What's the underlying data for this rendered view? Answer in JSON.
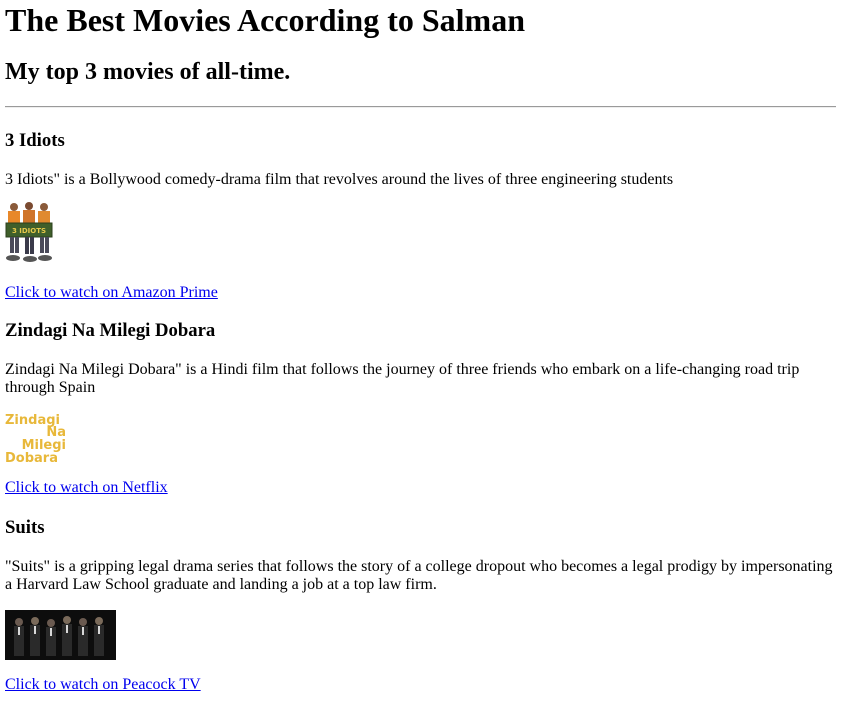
{
  "page": {
    "title": "The Best Movies According to Salman",
    "subtitle": "My top 3 movies of all-time."
  },
  "movies": [
    {
      "title": "3 Idiots",
      "description": "3 Idiots\" is a Bollywood comedy-drama film that revolves around the lives of three engineering students",
      "image_text": "3 IDIOTS",
      "link": "Click to watch on Amazon Prime"
    },
    {
      "title": "Zindagi Na Milegi Dobara",
      "description": "Zindagi Na Milegi Dobara\" is a Hindi film that follows the journey of three friends who embark on a life-changing road trip through Spain",
      "image_text": [
        "Zindagi",
        "Na",
        "Milegi",
        "Dobara"
      ],
      "link": "Click to watch on Netflix"
    },
    {
      "title": "Suits",
      "description": "\"Suits\" is a gripping legal drama series that follows the story of a college dropout who becomes a legal prodigy by impersonating a Harvard Law School graduate and landing a job at a top law firm.",
      "link": "Click to watch on Peacock TV"
    }
  ],
  "colors": {
    "link": "#0000ee",
    "logo_yellow": "#e8b83a"
  }
}
